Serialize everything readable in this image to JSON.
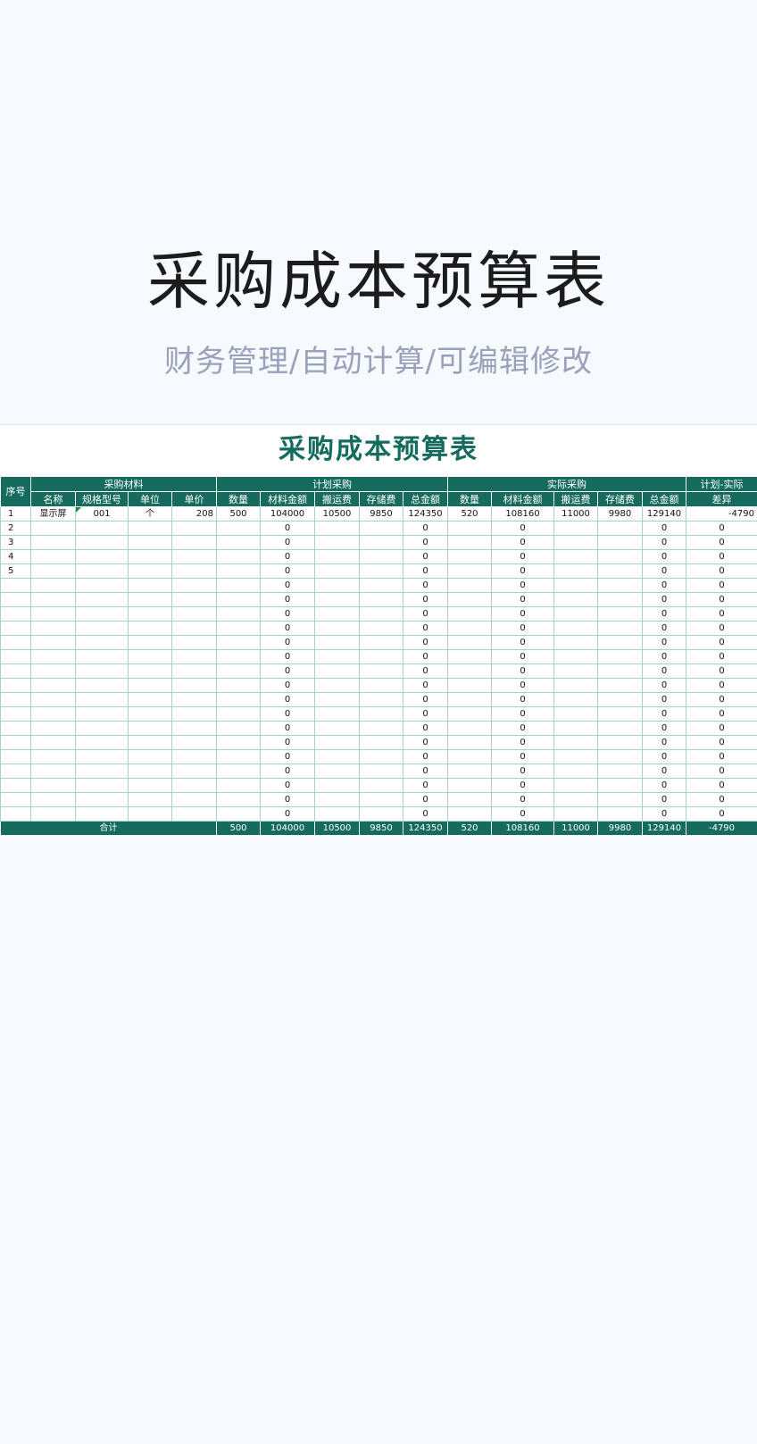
{
  "banner": {
    "title": "采购成本预算表",
    "subtitle": "财务管理/自动计算/可编辑修改"
  },
  "sheet": {
    "title": "采购成本预算表",
    "groups": {
      "seq": "序号",
      "material": "采购材料",
      "plan": "计划采购",
      "actual": "实际采购",
      "diff_top": "计划-实际",
      "diff_bottom": "差异"
    },
    "material_cols": [
      "名称",
      "规格型号",
      "单位",
      "单价"
    ],
    "plan_cols": [
      "数量",
      "材料金额",
      "搬运费",
      "存储费",
      "总金额"
    ],
    "actual_cols": [
      "数量",
      "材料金额",
      "搬运费",
      "存储费",
      "总金额"
    ],
    "rows": [
      [
        "1",
        "显示屏",
        "001",
        "个",
        "208",
        "500",
        "104000",
        "10500",
        "9850",
        "124350",
        "520",
        "108160",
        "11000",
        "9980",
        "129140",
        "-4790"
      ],
      [
        "2",
        "",
        "",
        "",
        "",
        "",
        "0",
        "",
        "",
        "0",
        "",
        "0",
        "",
        "",
        "0",
        "0"
      ],
      [
        "3",
        "",
        "",
        "",
        "",
        "",
        "0",
        "",
        "",
        "0",
        "",
        "0",
        "",
        "",
        "0",
        "0"
      ],
      [
        "4",
        "",
        "",
        "",
        "",
        "",
        "0",
        "",
        "",
        "0",
        "",
        "0",
        "",
        "",
        "0",
        "0"
      ],
      [
        "5",
        "",
        "",
        "",
        "",
        "",
        "0",
        "",
        "",
        "0",
        "",
        "0",
        "",
        "",
        "0",
        "0"
      ],
      [
        "",
        "",
        "",
        "",
        "",
        "",
        "0",
        "",
        "",
        "0",
        "",
        "0",
        "",
        "",
        "0",
        "0"
      ],
      [
        "",
        "",
        "",
        "",
        "",
        "",
        "0",
        "",
        "",
        "0",
        "",
        "0",
        "",
        "",
        "0",
        "0"
      ],
      [
        "",
        "",
        "",
        "",
        "",
        "",
        "0",
        "",
        "",
        "0",
        "",
        "0",
        "",
        "",
        "0",
        "0"
      ],
      [
        "",
        "",
        "",
        "",
        "",
        "",
        "0",
        "",
        "",
        "0",
        "",
        "0",
        "",
        "",
        "0",
        "0"
      ],
      [
        "",
        "",
        "",
        "",
        "",
        "",
        "0",
        "",
        "",
        "0",
        "",
        "0",
        "",
        "",
        "0",
        "0"
      ],
      [
        "",
        "",
        "",
        "",
        "",
        "",
        "0",
        "",
        "",
        "0",
        "",
        "0",
        "",
        "",
        "0",
        "0"
      ],
      [
        "",
        "",
        "",
        "",
        "",
        "",
        "0",
        "",
        "",
        "0",
        "",
        "0",
        "",
        "",
        "0",
        "0"
      ],
      [
        "",
        "",
        "",
        "",
        "",
        "",
        "0",
        "",
        "",
        "0",
        "",
        "0",
        "",
        "",
        "0",
        "0"
      ],
      [
        "",
        "",
        "",
        "",
        "",
        "",
        "0",
        "",
        "",
        "0",
        "",
        "0",
        "",
        "",
        "0",
        "0"
      ],
      [
        "",
        "",
        "",
        "",
        "",
        "",
        "0",
        "",
        "",
        "0",
        "",
        "0",
        "",
        "",
        "0",
        "0"
      ],
      [
        "",
        "",
        "",
        "",
        "",
        "",
        "0",
        "",
        "",
        "0",
        "",
        "0",
        "",
        "",
        "0",
        "0"
      ],
      [
        "",
        "",
        "",
        "",
        "",
        "",
        "0",
        "",
        "",
        "0",
        "",
        "0",
        "",
        "",
        "0",
        "0"
      ],
      [
        "",
        "",
        "",
        "",
        "",
        "",
        "0",
        "",
        "",
        "0",
        "",
        "0",
        "",
        "",
        "0",
        "0"
      ],
      [
        "",
        "",
        "",
        "",
        "",
        "",
        "0",
        "",
        "",
        "0",
        "",
        "0",
        "",
        "",
        "0",
        "0"
      ],
      [
        "",
        "",
        "",
        "",
        "",
        "",
        "0",
        "",
        "",
        "0",
        "",
        "0",
        "",
        "",
        "0",
        "0"
      ],
      [
        "",
        "",
        "",
        "",
        "",
        "",
        "0",
        "",
        "",
        "0",
        "",
        "0",
        "",
        "",
        "0",
        "0"
      ],
      [
        "",
        "",
        "",
        "",
        "",
        "",
        "0",
        "",
        "",
        "0",
        "",
        "0",
        "",
        "",
        "0",
        "0"
      ]
    ],
    "total": {
      "label": "合计",
      "values": [
        "500",
        "104000",
        "10500",
        "9850",
        "124350",
        "520",
        "108160",
        "11000",
        "9980",
        "129140",
        "-4790"
      ]
    }
  }
}
